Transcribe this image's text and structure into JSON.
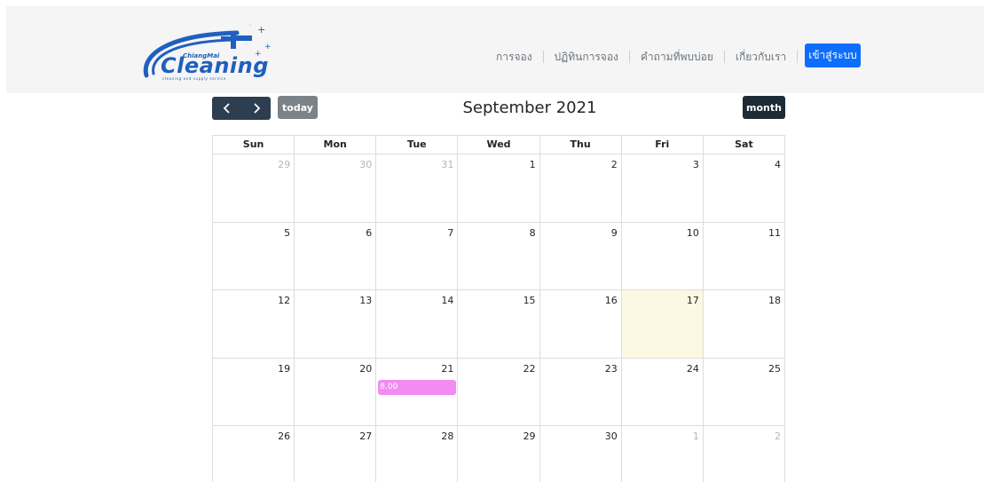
{
  "logo": {
    "small_text": "ChiangMai",
    "brand_text": "Cleaning",
    "tagline": "cleaning and supply service"
  },
  "nav": {
    "items": [
      "การจอง",
      "ปฏิทินการจอง",
      "คำถามที่พบบ่อย",
      "เกี่ยวกับเรา"
    ],
    "login_label": "เข้าสู่ระบบ"
  },
  "toolbar": {
    "prev_icon": "chevron-left-icon",
    "next_icon": "chevron-right-icon",
    "today_label": "today",
    "title": "September 2021",
    "month_label": "month"
  },
  "calendar": {
    "day_headers": [
      "Sun",
      "Mon",
      "Tue",
      "Wed",
      "Thu",
      "Fri",
      "Sat"
    ],
    "weeks": [
      [
        {
          "n": "29",
          "other": true
        },
        {
          "n": "30",
          "other": true
        },
        {
          "n": "31",
          "other": true
        },
        {
          "n": "1"
        },
        {
          "n": "2"
        },
        {
          "n": "3"
        },
        {
          "n": "4"
        }
      ],
      [
        {
          "n": "5"
        },
        {
          "n": "6"
        },
        {
          "n": "7"
        },
        {
          "n": "8"
        },
        {
          "n": "9"
        },
        {
          "n": "10"
        },
        {
          "n": "11"
        }
      ],
      [
        {
          "n": "12"
        },
        {
          "n": "13"
        },
        {
          "n": "14"
        },
        {
          "n": "15"
        },
        {
          "n": "16"
        },
        {
          "n": "17",
          "today": true
        },
        {
          "n": "18"
        }
      ],
      [
        {
          "n": "19"
        },
        {
          "n": "20"
        },
        {
          "n": "21",
          "event": "8.00"
        },
        {
          "n": "22"
        },
        {
          "n": "23"
        },
        {
          "n": "24"
        },
        {
          "n": "25"
        }
      ],
      [
        {
          "n": "26"
        },
        {
          "n": "27"
        },
        {
          "n": "28"
        },
        {
          "n": "29"
        },
        {
          "n": "30"
        },
        {
          "n": "1",
          "other": true
        },
        {
          "n": "2",
          "other": true
        }
      ]
    ]
  },
  "colors": {
    "header_bg": "#f5f5f5",
    "login_button": "#0d6efd",
    "nav_button_group": "#2c3e50",
    "today_button": "#7b8288",
    "month_button": "#1e2b37",
    "today_cell": "#fcf8e3",
    "event": "#f28cf2",
    "logo_blue": "#1f5fbf"
  }
}
